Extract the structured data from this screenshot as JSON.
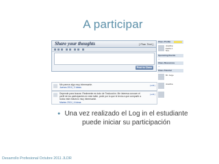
{
  "slide": {
    "title": "A participar",
    "bullet_glyph": "●",
    "caption": "Una vez realizado el Log in el estudiante puede iniciar su participación",
    "footer": "Desarrollo Profesional Octubre 2011 JLDR"
  },
  "screenshot": {
    "box_title": "Share your thoughts",
    "box_link": "[ Plan Text ]",
    "post_button": "Post to Class",
    "entries": [
      {
        "text": "Me parece algo muy interesante.",
        "meta": "Jueves 2011 | 3 ideas",
        "reply": "[ edit ]"
      },
      {
        "text": "Depende para buscar. Realmente es todo de Traducción. Me interesa conocer el perfil de los participantes en este taller, pedir por lo que le tenía a que compartir a todos este esfuerzo muy interesante.",
        "meta": "Martes 2011 | 4 ideas",
        "reply": "[ edit ]"
      }
    ],
    "sidebar": {
      "user_header": "Class Profile",
      "user_badge": "",
      "user_lines": [
        "Josefina",
        "Fecha J.",
        "Nov."
      ],
      "section_1": "Upcoming Events",
      "section_2": "Class Resources",
      "section_3": "Class Tutorial",
      "person_1": "Mr. Jorge",
      "person_2": "Josefina"
    }
  }
}
